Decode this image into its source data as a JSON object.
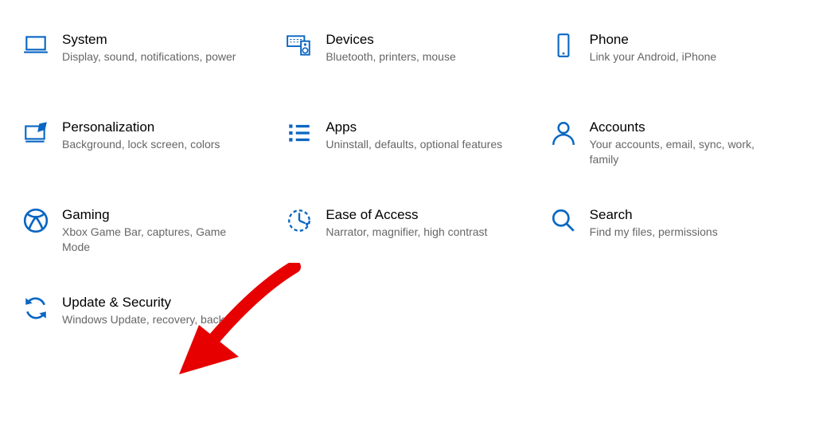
{
  "accent": "#0a66c2",
  "tiles": [
    {
      "id": "system",
      "title": "System",
      "desc": "Display, sound, notifications, power",
      "icon": "system-icon"
    },
    {
      "id": "devices",
      "title": "Devices",
      "desc": "Bluetooth, printers, mouse",
      "icon": "devices-icon"
    },
    {
      "id": "phone",
      "title": "Phone",
      "desc": "Link your Android, iPhone",
      "icon": "phone-icon"
    },
    {
      "id": "personalization",
      "title": "Personalization",
      "desc": "Background, lock screen, colors",
      "icon": "personalization-icon"
    },
    {
      "id": "apps",
      "title": "Apps",
      "desc": "Uninstall, defaults, optional features",
      "icon": "apps-icon"
    },
    {
      "id": "accounts",
      "title": "Accounts",
      "desc": "Your accounts, email, sync, work, family",
      "icon": "accounts-icon"
    },
    {
      "id": "gaming",
      "title": "Gaming",
      "desc": "Xbox Game Bar, captures, Game Mode",
      "icon": "gaming-icon"
    },
    {
      "id": "ease-of-access",
      "title": "Ease of Access",
      "desc": "Narrator, magnifier, high contrast",
      "icon": "ease-of-access-icon"
    },
    {
      "id": "search",
      "title": "Search",
      "desc": "Find my files, permissions",
      "icon": "search-icon"
    },
    {
      "id": "update-security",
      "title": "Update & Security",
      "desc": "Windows Update, recovery, backup",
      "icon": "update-icon"
    }
  ]
}
